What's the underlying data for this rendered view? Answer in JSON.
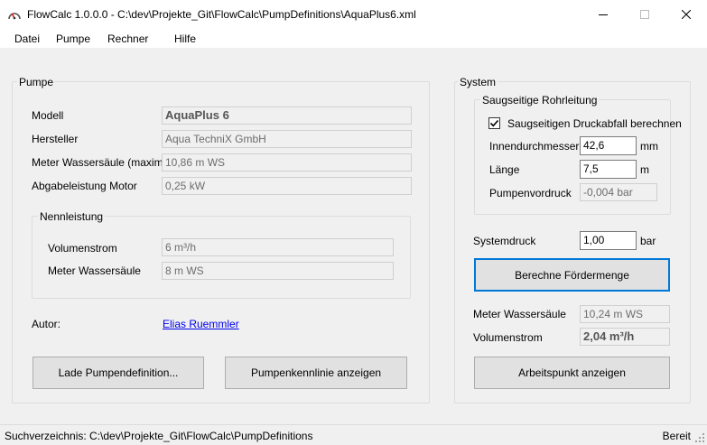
{
  "window": {
    "title": "FlowCalc 1.0.0.0 - C:\\dev\\Projekte_Git\\FlowCalc\\PumpDefinitions\\AquaPlus6.xml",
    "icon": "gauge-icon"
  },
  "menu": {
    "items": [
      "Datei",
      "Pumpe",
      "Rechner",
      "Hilfe"
    ]
  },
  "pump": {
    "group_label": "Pumpe",
    "model_label": "Modell",
    "model_value": "AquaPlus 6",
    "manufacturer_label": "Hersteller",
    "manufacturer_value": "Aqua TechniX GmbH",
    "max_head_label": "Meter Wassersäule (maximal)",
    "max_head_value": "10,86 m WS",
    "motor_power_label": "Abgabeleistung Motor",
    "motor_power_value": "0,25 kW",
    "nominal": {
      "group_label": "Nennleistung",
      "flow_label": "Volumenstrom",
      "flow_value": "6 m³/h",
      "head_label": "Meter Wassersäule",
      "head_value": "8 m WS"
    },
    "author_label": "Autor:",
    "author_value": "Elias Ruemmler",
    "load_button": "Lade Pumpendefinition...",
    "curve_button": "Pumpenkennlinie anzeigen"
  },
  "system": {
    "group_label": "System",
    "suction": {
      "group_label": "Saugseitige Rohrleitung",
      "checkbox_label": "Saugseitigen Druckabfall berechnen",
      "checkbox_checked": true,
      "diameter_label": "Innendurchmesser",
      "diameter_value": "42,6",
      "diameter_unit": "mm",
      "length_label": "Länge",
      "length_value": "7,5",
      "length_unit": "m",
      "pre_pressure_label": "Pumpenvordruck",
      "pre_pressure_value": "-0,004 bar"
    },
    "system_pressure_label": "Systemdruck",
    "system_pressure_value": "1,00",
    "system_pressure_unit": "bar",
    "calc_button": "Berechne Fördermenge",
    "result_head_label": "Meter Wassersäule",
    "result_head_value": "10,24 m WS",
    "result_flow_label": "Volumenstrom",
    "result_flow_value": "2,04 m³/h",
    "operating_point_button": "Arbeitspunkt anzeigen"
  },
  "status": {
    "path": "Suchverzeichnis: C:\\dev\\Projekte_Git\\FlowCalc\\PumpDefinitions",
    "state": "Bereit"
  }
}
